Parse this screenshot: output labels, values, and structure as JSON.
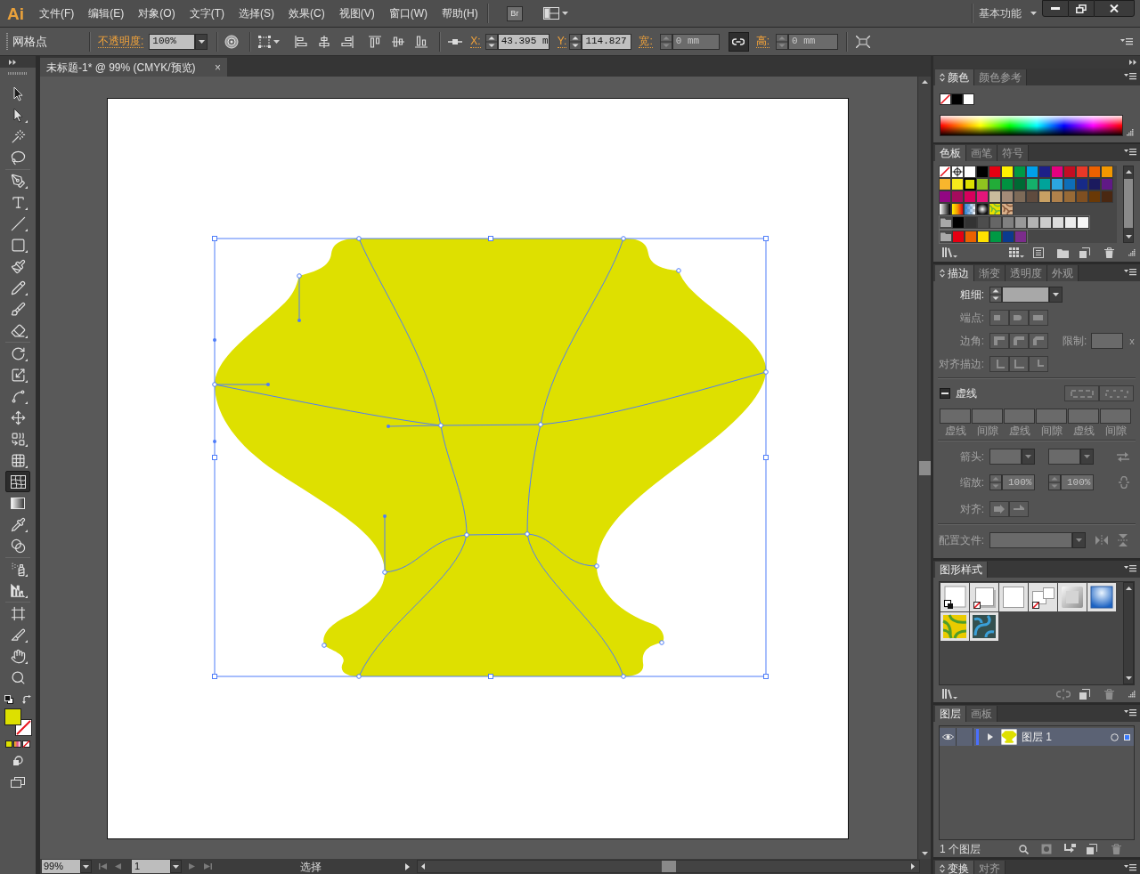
{
  "menu_bar": {
    "logo": "Ai",
    "items": [
      "文件(F)",
      "编辑(E)",
      "对象(O)",
      "文字(T)",
      "选择(S)",
      "效果(C)",
      "视图(V)",
      "窗口(W)",
      "帮助(H)"
    ],
    "bridge": "Br",
    "workspace": "基本功能"
  },
  "control_bar": {
    "selection": "网格点",
    "opacity": {
      "label": "不透明度:",
      "value": "100%"
    },
    "x": {
      "label": "X:",
      "value": "43.395 m",
      "disabled": false
    },
    "y": {
      "label": "Y:",
      "value": "114.827",
      "disabled": false
    },
    "width": {
      "label": "宽:",
      "value": "0 mm",
      "disabled": true
    },
    "height": {
      "label": "高:",
      "value": "0 mm",
      "disabled": true
    },
    "constrain": {
      "on": true
    }
  },
  "document_tab": {
    "title": "未标题-1* @ 99% (CMYK/预览)",
    "close": "×"
  },
  "tool_groups": [
    [
      {
        "kind": "selection",
        "selected": false
      },
      {
        "kind": "direct-selection",
        "selected": false
      },
      {
        "kind": "magic-wand",
        "selected": false
      },
      {
        "kind": "lasso",
        "selected": false
      }
    ],
    [
      {
        "kind": "pen",
        "selected": false
      },
      {
        "kind": "type",
        "selected": false
      },
      {
        "kind": "line",
        "selected": false
      },
      {
        "kind": "rectangle",
        "selected": false
      },
      {
        "kind": "paintbrush",
        "selected": false
      },
      {
        "kind": "pencil",
        "selected": false
      },
      {
        "kind": "blob-brush",
        "selected": false
      },
      {
        "kind": "eraser",
        "selected": false
      }
    ],
    [
      {
        "kind": "rotate",
        "selected": false
      },
      {
        "kind": "scale",
        "selected": false
      },
      {
        "kind": "width",
        "selected": false
      },
      {
        "kind": "free-transform",
        "selected": false
      },
      {
        "kind": "shape-builder",
        "selected": false
      },
      {
        "kind": "perspective-grid",
        "selected": false
      },
      {
        "kind": "mesh",
        "selected": true
      },
      {
        "kind": "gradient",
        "selected": false
      },
      {
        "kind": "eyedropper",
        "selected": false
      },
      {
        "kind": "blend",
        "selected": false
      }
    ],
    [
      {
        "kind": "symbol-sprayer",
        "selected": false
      },
      {
        "kind": "column-graph",
        "selected": false
      }
    ],
    [
      {
        "kind": "artboard",
        "selected": false
      },
      {
        "kind": "slice",
        "selected": false
      },
      {
        "kind": "hand",
        "selected": false
      },
      {
        "kind": "zoom",
        "selected": false
      }
    ]
  ],
  "fill_stroke": {
    "fill": {
      "kind": "color",
      "color": "#dde000"
    },
    "stroke": {
      "kind": "none"
    }
  },
  "panels": {
    "color": {
      "tabs": [
        {
          "label": "颜色",
          "selected": true
        },
        {
          "label": "颜色参考",
          "selected": false
        }
      ],
      "quick_swatches": [
        {
          "kind": "none"
        },
        {
          "kind": "color",
          "color": "#000000"
        },
        {
          "kind": "color",
          "color": "#ffffff"
        }
      ]
    },
    "swatches": {
      "tabs": [
        {
          "label": "色板",
          "selected": true
        },
        {
          "label": "画笔",
          "selected": false
        },
        {
          "label": "符号",
          "selected": false
        }
      ],
      "swatches": [
        {
          "kind": "none",
          "selected": false
        },
        {
          "kind": "registration",
          "selected": false
        },
        {
          "kind": "color",
          "color": "#ffffff",
          "selected": false
        },
        {
          "kind": "color",
          "color": "#000000",
          "selected": false
        },
        {
          "kind": "color",
          "color": "#e60012",
          "selected": false
        },
        {
          "kind": "color",
          "color": "#fff100",
          "selected": false
        },
        {
          "kind": "color",
          "color": "#009944",
          "selected": false
        },
        {
          "kind": "color",
          "color": "#00a0e9",
          "selected": false
        },
        {
          "kind": "color",
          "color": "#1d2088",
          "selected": false
        },
        {
          "kind": "color",
          "color": "#e4007f",
          "selected": false
        },
        {
          "kind": "color",
          "color": "#c30d23",
          "selected": false
        },
        {
          "kind": "color",
          "color": "#e83828",
          "selected": false
        },
        {
          "kind": "color",
          "color": "#eb6100",
          "selected": false
        },
        {
          "kind": "color",
          "color": "#f39800",
          "selected": false
        },
        {
          "kind": "color",
          "color": "#f8b62d",
          "selected": false
        },
        {
          "kind": "color",
          "color": "#f6ea1c",
          "selected": false
        },
        {
          "kind": "color",
          "color": "#dde000",
          "selected": true
        },
        {
          "kind": "color",
          "color": "#8fc31f",
          "selected": false
        },
        {
          "kind": "color",
          "color": "#22ac38",
          "selected": false
        },
        {
          "kind": "color",
          "color": "#009140",
          "selected": false
        },
        {
          "kind": "color",
          "color": "#006934",
          "selected": false
        },
        {
          "kind": "color",
          "color": "#14b06b",
          "selected": false
        },
        {
          "kind": "color",
          "color": "#00a39a",
          "selected": false
        },
        {
          "kind": "color",
          "color": "#2ca6e0",
          "selected": false
        },
        {
          "kind": "color",
          "color": "#0e6eb8",
          "selected": false
        },
        {
          "kind": "color",
          "color": "#172a88",
          "selected": false
        },
        {
          "kind": "color",
          "color": "#1b1a5e",
          "selected": false
        },
        {
          "kind": "color",
          "color": "#601986",
          "selected": false
        },
        {
          "kind": "color",
          "color": "#920783",
          "selected": false
        },
        {
          "kind": "color",
          "color": "#a40b5d",
          "selected": false
        },
        {
          "kind": "color",
          "color": "#d7005c",
          "selected": false
        },
        {
          "kind": "color",
          "color": "#e4157a",
          "selected": false
        },
        {
          "kind": "color",
          "color": "#c9bc9c",
          "selected": false
        },
        {
          "kind": "color",
          "color": "#a48b78",
          "selected": false
        },
        {
          "kind": "color",
          "color": "#7d6a58",
          "selected": false
        },
        {
          "kind": "color",
          "color": "#5f4b3e",
          "selected": false
        },
        {
          "kind": "color",
          "color": "#c8a063",
          "selected": false
        },
        {
          "kind": "color",
          "color": "#b0814b",
          "selected": false
        },
        {
          "kind": "color",
          "color": "#986a36",
          "selected": false
        },
        {
          "kind": "color",
          "color": "#7f4f21",
          "selected": false
        },
        {
          "kind": "color",
          "color": "#6a3906",
          "selected": false
        },
        {
          "kind": "color",
          "color": "#4a2812",
          "selected": false
        },
        {
          "kind": "gray-gradient",
          "selected": false
        },
        {
          "kind": "warm-gradient",
          "selected": false
        },
        {
          "kind": "transparent-fade",
          "selected": false
        },
        {
          "kind": "radial-gradient",
          "selected": false
        },
        {
          "kind": "leaf-pattern",
          "selected": false
        },
        {
          "kind": "bark-pattern",
          "selected": false
        }
      ],
      "groups": [
        {
          "swatches": [
            {
              "color": "#000000",
              "selected": false
            },
            {
              "color": "#333333",
              "selected": false
            },
            {
              "color": "#4d4d4d",
              "selected": false
            },
            {
              "color": "#666666",
              "selected": false
            },
            {
              "color": "#808080",
              "selected": false
            },
            {
              "color": "#999999",
              "selected": false
            },
            {
              "color": "#b3b3b3",
              "selected": false
            },
            {
              "color": "#cccccc",
              "selected": false
            },
            {
              "color": "#dcdcdc",
              "selected": false
            },
            {
              "color": "#ececec",
              "selected": false
            },
            {
              "color": "#f7f7f7",
              "selected": false
            }
          ]
        },
        {
          "swatches": [
            {
              "color": "#e60012",
              "selected": false
            },
            {
              "color": "#eb6100",
              "selected": false
            },
            {
              "color": "#ffe100",
              "selected": false
            },
            {
              "color": "#009944",
              "selected": false
            },
            {
              "color": "#0b3a8f",
              "selected": false
            },
            {
              "color": "#7b2c8b",
              "selected": false
            }
          ]
        }
      ]
    },
    "stroke": {
      "tabs": [
        {
          "label": "描边",
          "selected": true
        },
        {
          "label": "渐变",
          "selected": false
        },
        {
          "label": "透明度",
          "selected": false
        },
        {
          "label": "外观",
          "selected": false
        }
      ],
      "weight": {
        "label": "粗细:",
        "disabled": false
      },
      "cap": {
        "label": "端点:",
        "disabled": true
      },
      "corner": {
        "label": "边角:",
        "limit_label": "限制:",
        "limit_unit": "x",
        "disabled": true
      },
      "align": {
        "label": "对齐描边:",
        "disabled": true
      },
      "dashed": {
        "label": "虚线",
        "indeterminate": true
      },
      "dashes": {
        "disabled": true,
        "fields": [
          "虚线",
          "间隙",
          "虚线",
          "间隙",
          "虚线",
          "间隙"
        ]
      },
      "arrowheads": {
        "label": "箭头:",
        "disabled": true
      },
      "scale": {
        "label": "缩放:",
        "start": "100%",
        "end": "100%",
        "disabled": true
      },
      "arrow_align": {
        "label": "对齐:",
        "disabled": true
      },
      "profile": {
        "label": "配置文件:",
        "disabled": true
      }
    },
    "graphic_styles": {
      "tabs": [
        {
          "label": "图形样式",
          "selected": true
        }
      ],
      "styles": [
        {
          "kind": "default"
        },
        {
          "kind": "shadow-none"
        },
        {
          "kind": "plain"
        },
        {
          "kind": "split-none"
        },
        {
          "kind": "bevel"
        },
        {
          "kind": "blue-glow"
        },
        {
          "kind": "green-texture"
        },
        {
          "kind": "teal-pattern"
        }
      ]
    },
    "layers": {
      "tabs": [
        {
          "label": "图层",
          "selected": true
        },
        {
          "label": "画板",
          "selected": false
        }
      ],
      "layers": [
        {
          "name": "图层 1",
          "visible": true,
          "expanded": false,
          "selected": true,
          "art_selected": true,
          "color": "#4a6fff"
        }
      ],
      "count": "1 个图层"
    },
    "collapsed": {
      "tabs": [
        {
          "label": "变换",
          "selected": true
        },
        {
          "label": "对齐",
          "selected": false
        }
      ]
    }
  },
  "status_bar": {
    "zoom": "99%",
    "artboard": "1",
    "tool": "选择"
  }
}
